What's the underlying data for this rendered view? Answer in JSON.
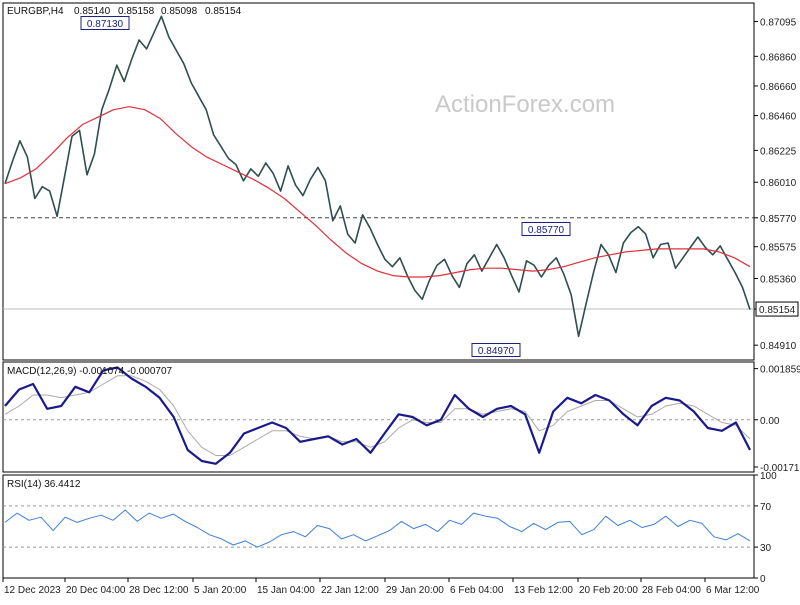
{
  "chart_data": [
    {
      "type": "line",
      "title": "EURGBP,H4",
      "ohlc": [
        "0.85140",
        "0.85158",
        "0.85098",
        "0.85154"
      ],
      "watermark": "ActionForex.com",
      "ylim": [
        0.8481,
        0.8722
      ],
      "y_ticks": [
        "0.87095",
        "0.86860",
        "0.86660",
        "0.86460",
        "0.86225",
        "0.86010",
        "0.85770",
        "0.85575",
        "0.85360",
        "0.85154",
        "0.84910"
      ],
      "y_tick_values": [
        0.87095,
        0.8686,
        0.8666,
        0.8646,
        0.86225,
        0.8601,
        0.8577,
        0.85575,
        0.8536,
        0.85154,
        0.8491
      ],
      "x_labels": [
        "12 Dec 2023",
        "20 Dec 04:00",
        "28 Dec 12:00",
        "5 Jan 20:00",
        "15 Jan 04:00",
        "22 Jan 12:00",
        "29 Jan 20:00",
        "6 Feb 04:00",
        "13 Feb 12:00",
        "20 Feb 20:00",
        "28 Feb 04:00",
        "6 Mar 12:00"
      ],
      "boxed_labels": [
        "0.87130",
        "0.85770",
        "0.84970"
      ],
      "horizontal_levels": [
        0.8577,
        0.85154
      ],
      "series": [
        {
          "name": "",
          "values": [
            0.86,
            0.8615,
            0.8629,
            0.8618,
            0.859,
            0.8598,
            0.8595,
            0.8578,
            0.8605,
            0.8632,
            0.8636,
            0.8606,
            0.862,
            0.865,
            0.8664,
            0.868,
            0.8669,
            0.8684,
            0.8697,
            0.8691,
            0.8702,
            0.8713,
            0.8699,
            0.869,
            0.8681,
            0.8668,
            0.8659,
            0.865,
            0.8633,
            0.8625,
            0.8617,
            0.8613,
            0.8602,
            0.861,
            0.8605,
            0.8614,
            0.8607,
            0.8595,
            0.8612,
            0.8599,
            0.8592,
            0.8603,
            0.8611,
            0.8602,
            0.8575,
            0.8585,
            0.8566,
            0.856,
            0.8579,
            0.857,
            0.8559,
            0.8549,
            0.8544,
            0.855,
            0.8538,
            0.8528,
            0.8522,
            0.8535,
            0.8545,
            0.8549,
            0.8538,
            0.853,
            0.8546,
            0.8552,
            0.8541,
            0.855,
            0.8559,
            0.855,
            0.8538,
            0.8527,
            0.8548,
            0.8545,
            0.8537,
            0.8545,
            0.855,
            0.8539,
            0.8525,
            0.8497,
            0.8519,
            0.854,
            0.8559,
            0.8552,
            0.854,
            0.856,
            0.8567,
            0.8571,
            0.8566,
            0.855,
            0.8559,
            0.856,
            0.8543,
            0.855,
            0.8557,
            0.8564,
            0.8557,
            0.8552,
            0.8558,
            0.8549,
            0.854,
            0.853,
            0.8515
          ]
        },
        {
          "name": "",
          "values": [
            0.86,
            0.8604,
            0.861,
            0.862,
            0.8631,
            0.864,
            0.8645,
            0.865,
            0.8652,
            0.865,
            0.8644,
            0.8634,
            0.8625,
            0.8618,
            0.8613,
            0.8608,
            0.8603,
            0.8597,
            0.859,
            0.8581,
            0.8572,
            0.8562,
            0.8553,
            0.8546,
            0.8541,
            0.8538,
            0.8537,
            0.8537,
            0.8538,
            0.854,
            0.8542,
            0.8543,
            0.8543,
            0.8542,
            0.8541,
            0.8542,
            0.8544,
            0.8547,
            0.855,
            0.8552,
            0.8554,
            0.8555,
            0.8556,
            0.8556,
            0.8556,
            0.8556,
            0.8554,
            0.855,
            0.8544
          ]
        }
      ]
    },
    {
      "type": "line",
      "title": "MACD(12,26,9) -0.001074 -0.000707",
      "ylim": [
        -0.0019,
        0.0021
      ],
      "y_ticks": [
        "0.001859",
        "0.00",
        "-0.001718"
      ],
      "y_tick_values": [
        0.001859,
        0.0,
        -0.001718
      ],
      "series": [
        {
          "name": "",
          "values": [
            0.0005,
            0.0011,
            0.0013,
            0.0004,
            0.0005,
            0.0012,
            0.001,
            0.0018,
            0.0019,
            0.0015,
            0.0012,
            0.0008,
            0.0001,
            -0.0011,
            -0.0015,
            -0.0016,
            -0.0012,
            -0.0005,
            -0.0003,
            -0.0001,
            -0.0003,
            -0.0008,
            -0.0007,
            -0.0006,
            -0.0009,
            -0.0007,
            -0.0012,
            -0.0005,
            0.0002,
            0.0001,
            -0.0002,
            0.0,
            0.0009,
            0.0004,
            0.0001,
            0.0004,
            0.0005,
            0.0002,
            -0.0012,
            0.0003,
            0.0008,
            0.0006,
            0.0009,
            0.0007,
            0.0002,
            -0.0002,
            0.0005,
            0.0008,
            0.0007,
            0.0003,
            -0.0003,
            -0.0004,
            -0.0001,
            -0.0011
          ]
        },
        {
          "name": "",
          "values": [
            0.0002,
            0.0005,
            0.0009,
            0.0009,
            0.0008,
            0.0009,
            0.001,
            0.0013,
            0.0016,
            0.0016,
            0.0014,
            0.0011,
            0.0005,
            -0.0004,
            -0.001,
            -0.0013,
            -0.0013,
            -0.001,
            -0.0007,
            -0.0004,
            -0.0004,
            -0.0006,
            -0.0007,
            -0.0006,
            -0.0008,
            -0.0008,
            -0.001,
            -0.0008,
            -0.0003,
            0.0,
            -0.0001,
            -0.0001,
            0.0004,
            0.0004,
            0.0002,
            0.0003,
            0.0004,
            0.0003,
            -0.0004,
            -0.0002,
            0.0003,
            0.0005,
            0.0007,
            0.0007,
            0.0004,
            0.0001,
            0.0002,
            0.0005,
            0.0006,
            0.0005,
            0.0002,
            -0.0001,
            -0.0002,
            -0.0007
          ]
        }
      ]
    },
    {
      "type": "line",
      "title": "RSI(14) 36.4412",
      "ylim": [
        0,
        100
      ],
      "y_ticks": [
        "100",
        "70",
        "30",
        "0"
      ],
      "y_tick_values": [
        100,
        70,
        30,
        0
      ],
      "series": [
        {
          "name": "",
          "values": [
            54,
            63,
            56,
            59,
            46,
            59,
            54,
            58,
            61,
            56,
            66,
            55,
            63,
            58,
            62,
            55,
            49,
            42,
            38,
            32,
            36,
            30,
            35,
            42,
            45,
            40,
            51,
            48,
            38,
            42,
            36,
            41,
            46,
            55,
            48,
            52,
            45,
            56,
            52,
            63,
            60,
            58,
            50,
            45,
            53,
            47,
            54,
            55,
            42,
            47,
            60,
            51,
            56,
            49,
            52,
            60,
            50,
            56,
            53,
            40,
            37,
            43,
            36
          ]
        }
      ]
    }
  ]
}
